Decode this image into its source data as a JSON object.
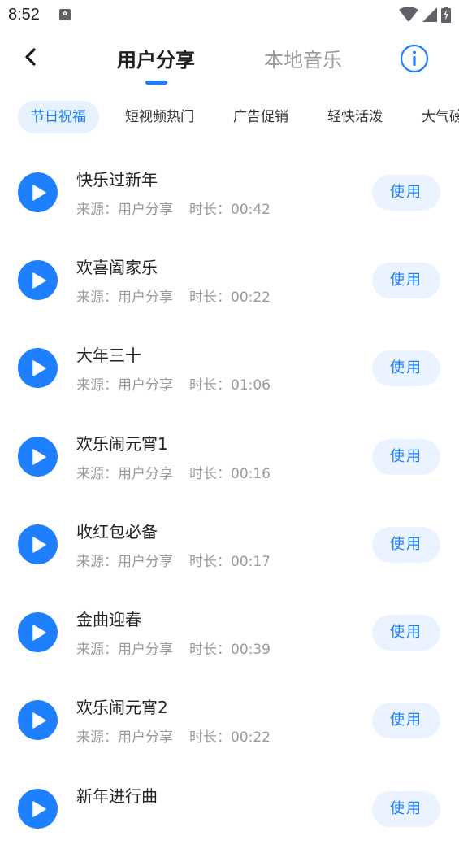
{
  "status_bar": {
    "time": "8:52",
    "notification_icon": "A"
  },
  "nav": {
    "tabs": [
      {
        "label": "用户分享",
        "active": true
      },
      {
        "label": "本地音乐",
        "active": false
      }
    ]
  },
  "categories": [
    {
      "label": "节日祝福",
      "active": true
    },
    {
      "label": "短视频热门",
      "active": false
    },
    {
      "label": "广告促销",
      "active": false
    },
    {
      "label": "轻快活泼",
      "active": false
    },
    {
      "label": "大气磅",
      "active": false
    }
  ],
  "songs": [
    {
      "title": "快乐过新年",
      "source": "来源：用户分享",
      "duration": "时长：00:42",
      "action": "使用"
    },
    {
      "title": "欢喜阖家乐",
      "source": "来源：用户分享",
      "duration": "时长：00:22",
      "action": "使用"
    },
    {
      "title": "大年三十",
      "source": "来源：用户分享",
      "duration": "时长：01:06",
      "action": "使用"
    },
    {
      "title": "欢乐闹元宵1",
      "source": "来源：用户分享",
      "duration": "时长：00:16",
      "action": "使用"
    },
    {
      "title": "收红包必备",
      "source": "来源：用户分享",
      "duration": "时长：00:17",
      "action": "使用"
    },
    {
      "title": "金曲迎春",
      "source": "来源：用户分享",
      "duration": "时长：00:39",
      "action": "使用"
    },
    {
      "title": "欢乐闹元宵2",
      "source": "来源：用户分享",
      "duration": "时长：00:22",
      "action": "使用"
    },
    {
      "title": "新年进行曲",
      "source": "",
      "duration": "",
      "action": "使用"
    }
  ],
  "colors": {
    "accent": "#1e80ff",
    "chip_bg": "#e8f2ff",
    "button_bg": "#eaf3ff"
  },
  "icons": {
    "back": "chevron-left-icon",
    "info": "info-circle-icon",
    "play": "play-icon",
    "wifi": "wifi-icon",
    "signal": "signal-icon",
    "battery": "battery-charging-icon"
  }
}
